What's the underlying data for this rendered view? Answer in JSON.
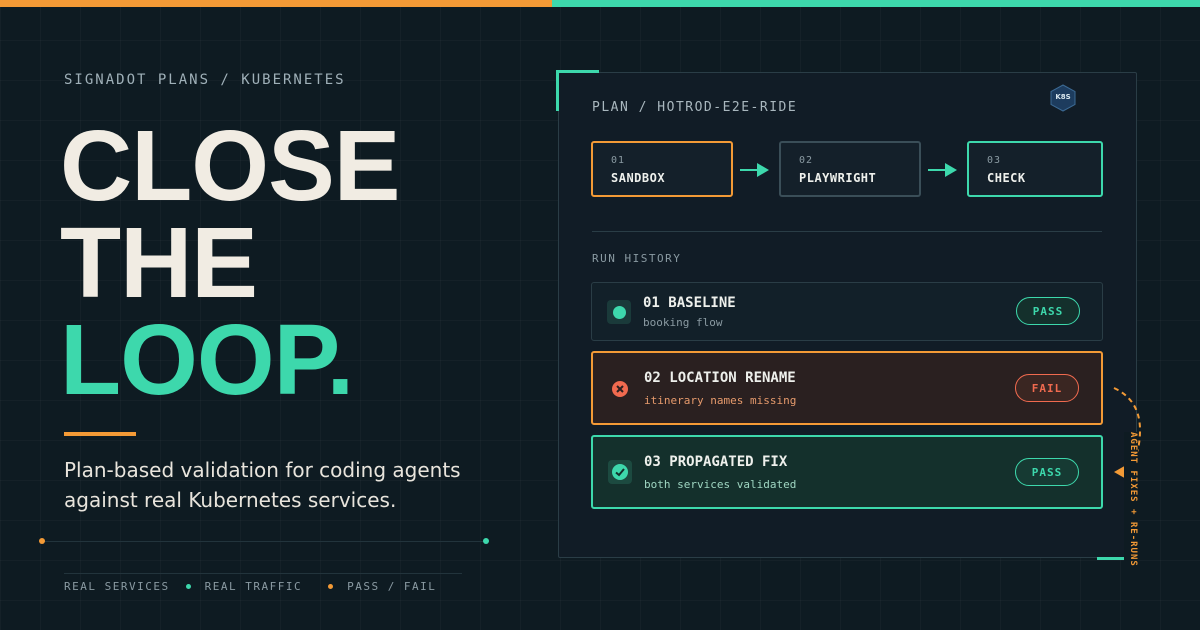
{
  "colors": {
    "orange": "#f39a36",
    "teal": "#3dd8ac",
    "red": "#f06a4f",
    "cream": "#f1ece3"
  },
  "left": {
    "eyebrow": "SIGNADOT PLANS / KUBERNETES",
    "headline": [
      "CLOSE",
      "THE",
      "LOOP."
    ],
    "subtitle": "Plan-based validation for coding agents against real Kubernetes services.",
    "footer": [
      "REAL SERVICES",
      "REAL TRAFFIC",
      "PASS / FAIL"
    ]
  },
  "panel": {
    "title": "PLAN / HOTROD-E2E-RIDE",
    "badge": "K8S",
    "steps": [
      {
        "num": "01",
        "name": "SANDBOX"
      },
      {
        "num": "02",
        "name": "PLAYWRIGHT"
      },
      {
        "num": "03",
        "name": "CHECK"
      }
    ],
    "run_history_label": "RUN HISTORY",
    "runs": [
      {
        "title": "01 BASELINE",
        "desc": "booking flow",
        "status": "PASS"
      },
      {
        "title": "02 LOCATION RENAME",
        "desc": "itinerary names missing",
        "status": "FAIL"
      },
      {
        "title": "03 PROPAGATED FIX",
        "desc": "both services validated",
        "status": "PASS"
      }
    ],
    "loop_label": "AGENT FIXES + RE-RUNS"
  }
}
